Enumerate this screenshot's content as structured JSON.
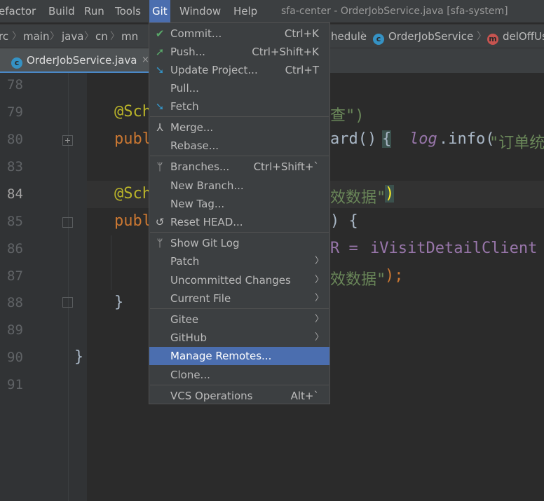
{
  "menubar": {
    "items": [
      "efactor",
      "Build",
      "Run",
      "Tools",
      "Git",
      "Window",
      "Help"
    ],
    "title": "sfa-center - OrderJobService.java [sfa-system]"
  },
  "breadcrumb": {
    "items": [
      "rc",
      "main",
      "java",
      "cn",
      "mn",
      "hedule",
      "OrderJobService",
      "delOffUs"
    ]
  },
  "tab": {
    "label": "OrderJobService.java",
    "close": "×"
  },
  "gutter": {
    "lines": [
      "78",
      "79",
      "80",
      "83",
      "84",
      "85",
      "86",
      "87",
      "88",
      "89",
      "90",
      "91"
    ]
  },
  "code": {
    "l79_anno": "@Sch",
    "l79_rest": "查\")",
    "l80_kw": "publ",
    "l80_a": "ard()",
    "l80_brace": "{",
    "l80_log": "log",
    "l80_b": ".info(",
    "l80_str": "\"订单统",
    "l84_anno": "@Sch",
    "l84_str": "效数据\"",
    "l84_paren": ")",
    "l85_kw": "publ",
    "l85_rest": ") {",
    "l86_a": "R = ",
    "l86_b": "iVisitDetailClient",
    "l87_str": "效数据\"",
    "l87_end": ");",
    "l88": "}",
    "l90": "}"
  },
  "git_menu": {
    "items": [
      {
        "label": "Commit...",
        "shortcut": "Ctrl+K",
        "icon": "check-icon"
      },
      {
        "label": "Push...",
        "shortcut": "Ctrl+Shift+K",
        "icon": "push-arrow-icon"
      },
      {
        "label": "Update Project...",
        "shortcut": "Ctrl+T",
        "icon": "update-arrow-icon"
      },
      {
        "label": "Pull...",
        "shortcut": "",
        "icon": ""
      },
      {
        "label": "Fetch",
        "shortcut": "",
        "icon": "fetch-arrow-icon"
      },
      {
        "label": "Merge...",
        "shortcut": "",
        "icon": "merge-icon"
      },
      {
        "label": "Rebase...",
        "shortcut": "",
        "icon": ""
      },
      {
        "label": "Branches...",
        "shortcut": "Ctrl+Shift+`",
        "icon": "branch-icon"
      },
      {
        "label": "New Branch...",
        "shortcut": "",
        "icon": ""
      },
      {
        "label": "New Tag...",
        "shortcut": "",
        "icon": ""
      },
      {
        "label": "Reset HEAD...",
        "shortcut": "",
        "icon": "reset-icon"
      },
      {
        "label": "Show Git Log",
        "shortcut": "",
        "icon": "branch-icon"
      },
      {
        "label": "Patch",
        "shortcut": "",
        "icon": "",
        "submenu": true
      },
      {
        "label": "Uncommitted Changes",
        "shortcut": "",
        "icon": "",
        "submenu": true
      },
      {
        "label": "Current File",
        "shortcut": "",
        "icon": "",
        "submenu": true
      },
      {
        "label": "Gitee",
        "shortcut": "",
        "icon": "",
        "submenu": true
      },
      {
        "label": "GitHub",
        "shortcut": "",
        "icon": "",
        "submenu": true
      },
      {
        "label": "Manage Remotes...",
        "shortcut": "",
        "icon": "",
        "selected": true
      },
      {
        "label": "Clone...",
        "shortcut": "",
        "icon": ""
      },
      {
        "label": "VCS Operations",
        "shortcut": "Alt+`",
        "icon": ""
      }
    ]
  },
  "colors": {
    "accent": "#4b6eaf",
    "check": "#59a869",
    "arrow_blue": "#3592c4"
  }
}
